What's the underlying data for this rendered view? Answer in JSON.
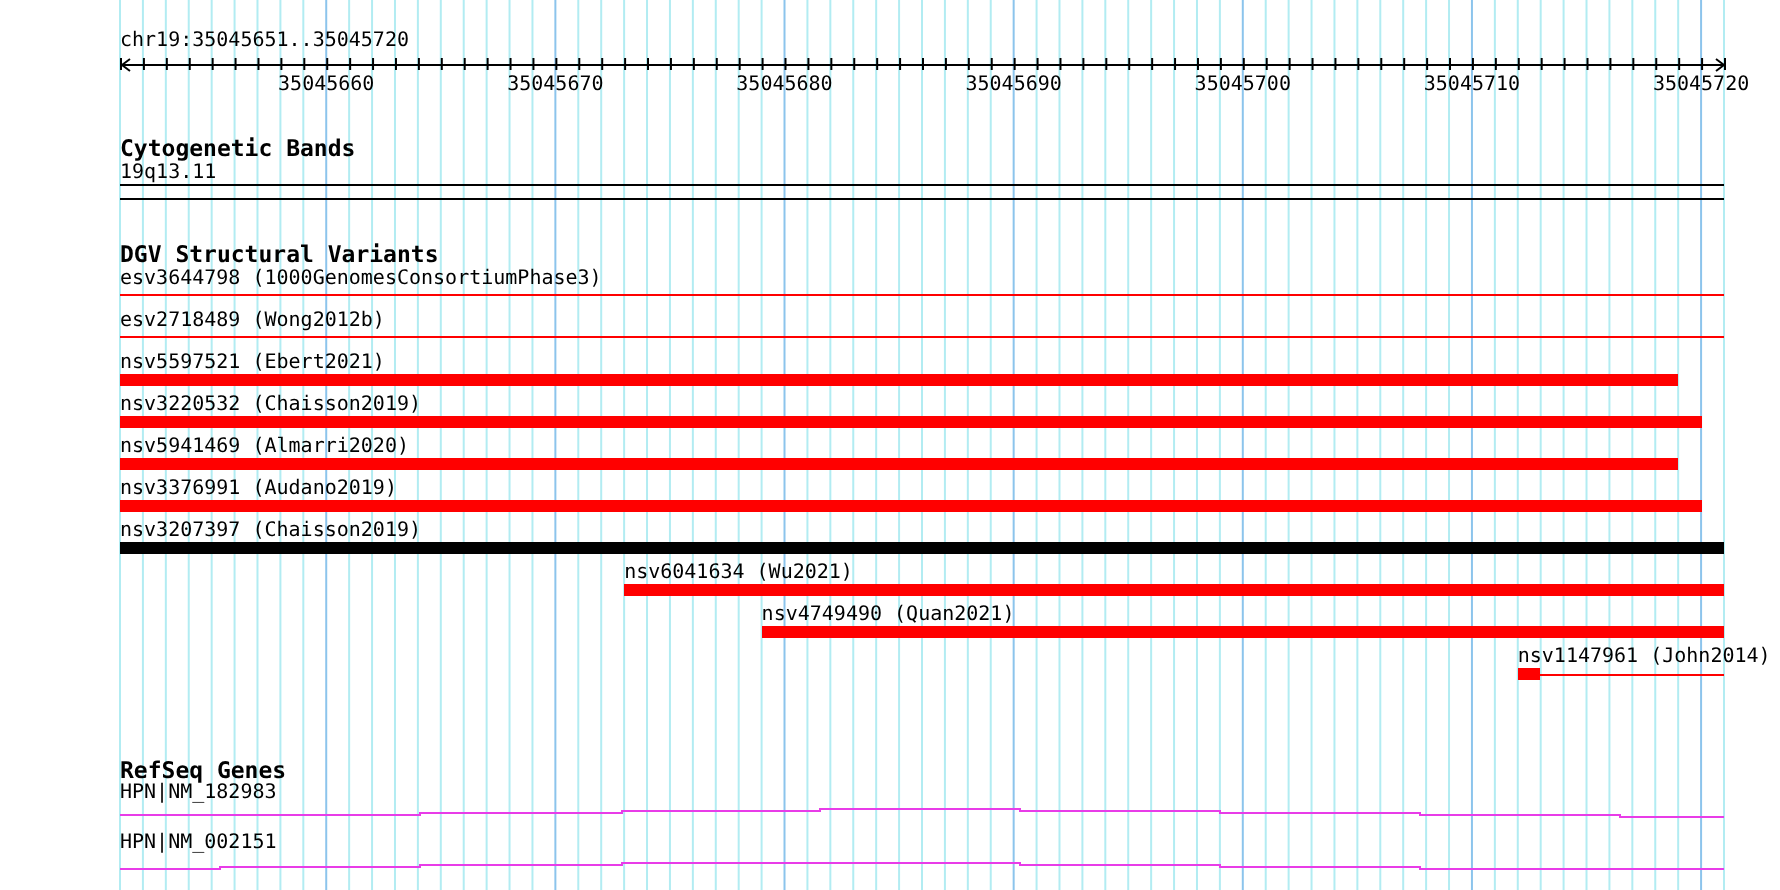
{
  "ruler": {
    "location": "chr19:35045651..35045720",
    "tick_labels": [
      "35045660",
      "35045670",
      "35045680",
      "35045690",
      "35045700",
      "35045710",
      "35045720"
    ]
  },
  "cytogenetic_bands": {
    "title": "Cytogenetic Bands",
    "band": "19q13.11"
  },
  "dgv_structural_variants": {
    "title": "DGV Structural Variants",
    "variants": [
      {
        "label": "esv3644798 (1000GenomesConsortiumPhase3)",
        "kind": "thin",
        "color": "#ff0000"
      },
      {
        "label": "esv2718489 (Wong2012b)",
        "kind": "thin",
        "color": "#ff0000"
      },
      {
        "label": "nsv5597521 (Ebert2021)",
        "kind": "thick",
        "color": "#ff0000",
        "clipped_left": true,
        "level": 0.9714
      },
      {
        "label": "nsv3220532 (Chaisson2019)",
        "kind": "thick",
        "color": "#ff0000",
        "clipped_left": true,
        "level": 0.9857
      },
      {
        "label": "nsv5941469 (Almarri2020)",
        "kind": "thick",
        "color": "#ff0000",
        "clipped_left": true,
        "level": 0.9714
      },
      {
        "label": "nsv3376991 (Audano2019)",
        "kind": "thick",
        "color": "#ff0000",
        "clipped_left": true,
        "level": 0.9857
      },
      {
        "label": "nsv3207397 (Chaisson2019)",
        "kind": "thick",
        "color": "#000000"
      },
      {
        "label": "nsv6041634 (Wu2021)",
        "kind": "thick",
        "color": "#ff0000",
        "clipped_left": false,
        "level": 0.6857
      },
      {
        "label": "nsv4749490 (Quan2021)",
        "kind": "thick",
        "color": "#ff0000",
        "clipped_left": false,
        "level": 0.6
      },
      {
        "label": "nsv1147961 (John2014)",
        "kind": "thick-thin",
        "color": "#ff0000",
        "clipped_left": false,
        "level": 0.1286,
        "thick": {
          "level": 0.1111
        }
      }
    ]
  },
  "refseq_genes": {
    "title": "RefSeq Genes",
    "genes": [
      {
        "label": "HPN|NM_182983"
      },
      {
        "label": "HPN|NM_002151"
      }
    ]
  }
}
